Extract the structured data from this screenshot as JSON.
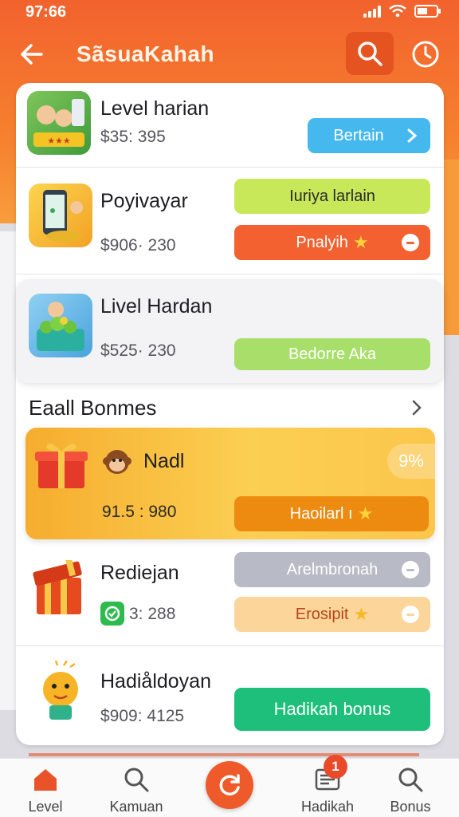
{
  "status_bar": {
    "time": "97:66"
  },
  "header": {
    "title": "SãsuaKahah"
  },
  "levels": [
    {
      "title": "Level harian",
      "price": "$35: 395",
      "action": "Bertain",
      "action_color": "#45b8ee"
    },
    {
      "title": "Poyivayar",
      "price": "$906· 230",
      "action_primary": "Iuriya larlain",
      "action_secondary": "Pnalyih",
      "primary_color": "#c8e85a",
      "secondary_color": "#f2612f"
    },
    {
      "title": "Livel Hardan",
      "price": "$525· 230",
      "action": "Bedorre Aka",
      "action_color": "#a8df6a"
    }
  ],
  "bonuses_section": {
    "title": "Eaall Bonmes"
  },
  "featured": {
    "title": "Nadl",
    "value": "91.5 : 980",
    "action": "Haoilarl ı",
    "badge": "9%",
    "action_color": "#ed8a10"
  },
  "bonuses": [
    {
      "title": "Rediejan",
      "value": "3: 288",
      "action_primary": "Arelmbronah",
      "action_secondary": "Erosipit",
      "primary_color": "#b8bac6",
      "secondary_color": "#fbd59a"
    },
    {
      "title": "Hadiåldoyan",
      "price": "$909: 4125",
      "action": "Hadikah bonus",
      "action_color": "#1dbf7a"
    }
  ],
  "bottom_nav": [
    {
      "label": "Level",
      "icon": "home-icon"
    },
    {
      "label": "Kamuan",
      "icon": "search-icon"
    },
    {
      "label": "",
      "icon": "refresh-icon"
    },
    {
      "label": "Hadikah",
      "icon": "gift-list-icon",
      "badge": "1"
    },
    {
      "label": "Bonus",
      "icon": "search-icon"
    }
  ],
  "colors": {
    "accent": "#f2622e",
    "highlight_green": "#1dbf7a"
  }
}
